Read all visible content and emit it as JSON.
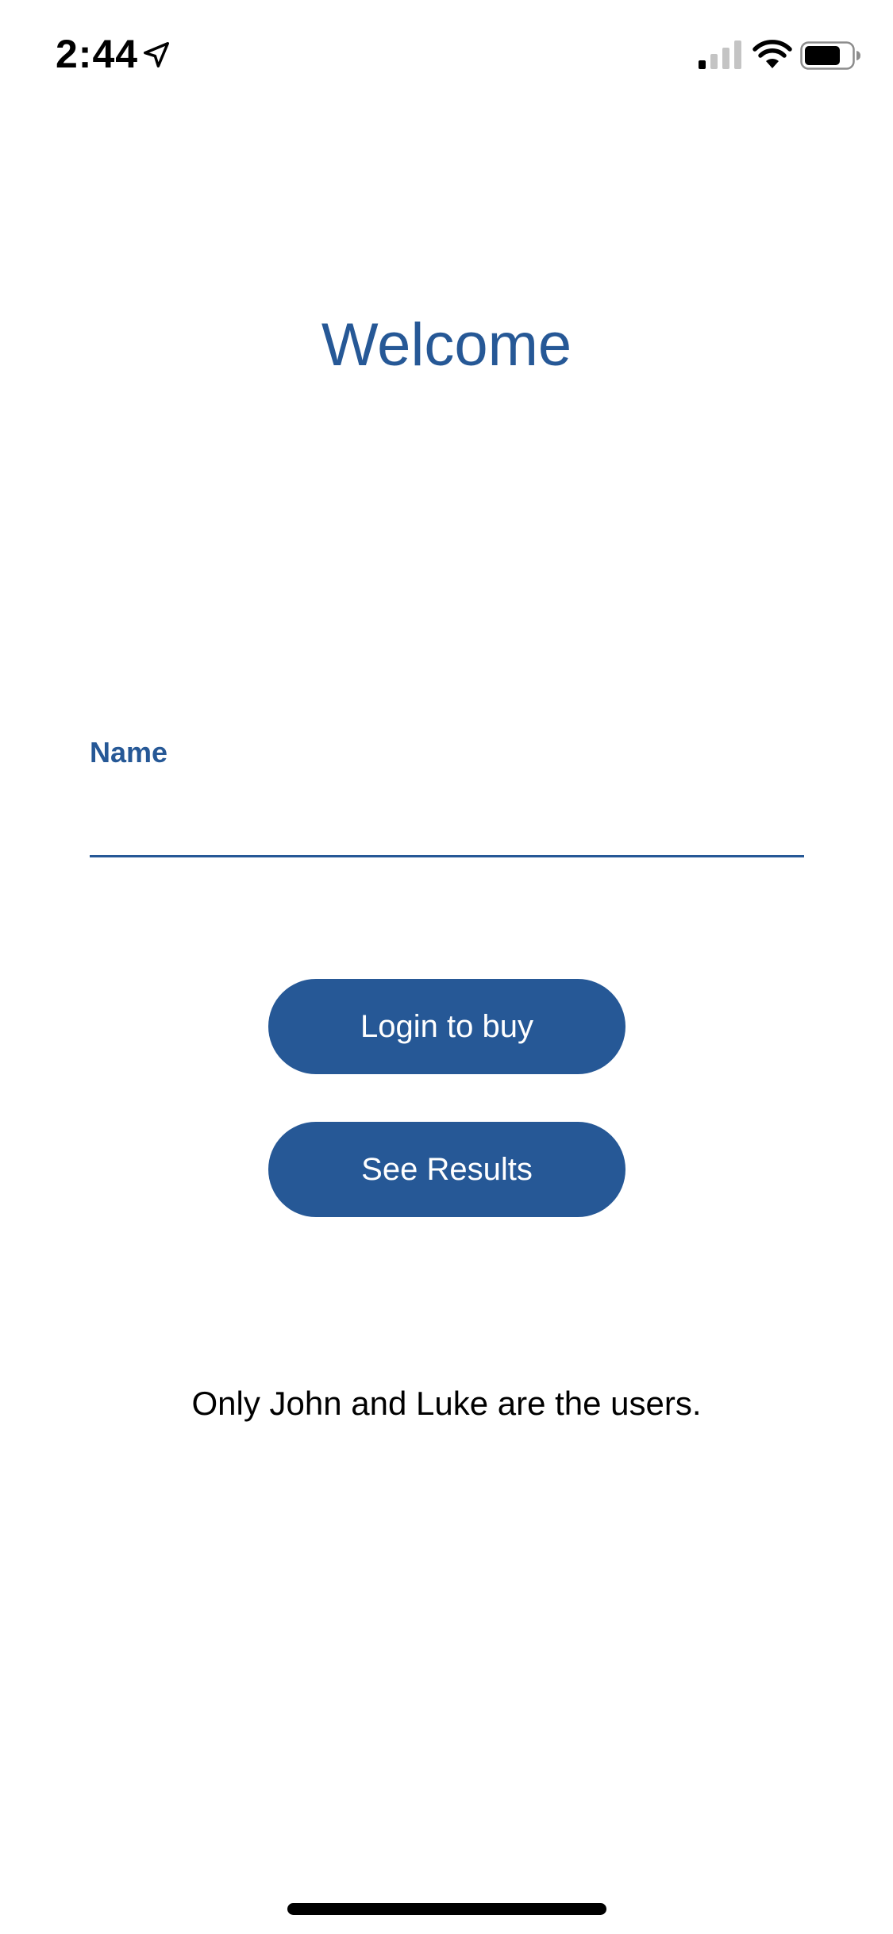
{
  "status_bar": {
    "time": "2:44",
    "icons": {
      "location": "location-arrow-icon",
      "signal": "cellular-signal-icon",
      "wifi": "wifi-icon",
      "battery": "battery-icon"
    }
  },
  "main": {
    "title": "Welcome",
    "name_field": {
      "label": "Name",
      "value": "",
      "placeholder": ""
    },
    "buttons": {
      "login_label": "Login to buy",
      "results_label": "See Results"
    },
    "info_text": "Only John and Luke are the users."
  },
  "colors": {
    "accent": "#265896",
    "background": "#ffffff",
    "text": "#000000"
  }
}
